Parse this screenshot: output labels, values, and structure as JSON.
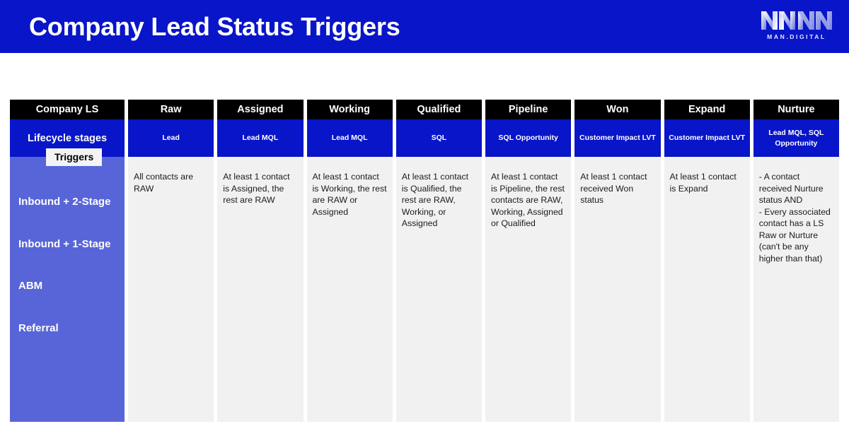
{
  "banner": {
    "title": "Company Lead Status Triggers",
    "bg_color": "#0915c8"
  },
  "logo": {
    "mark_name": "man-digital-zigzag-mark",
    "wordmark": "MAN.DIGITAL"
  },
  "table": {
    "sidebar": {
      "header": "Company LS",
      "stage_label": "Lifecycle stages",
      "badge": "Triggers",
      "rows": [
        {
          "label": "Inbound + 2-Stage"
        },
        {
          "label": "Inbound + 1-Stage"
        },
        {
          "label": "ABM"
        },
        {
          "label": "Referral"
        }
      ]
    },
    "columns": [
      {
        "header": "Raw",
        "stages": "Lead",
        "trigger": "All contacts are RAW"
      },
      {
        "header": "Assigned",
        "stages": "Lead\nMQL",
        "trigger": "At least 1 contact is Assigned, the rest are RAW"
      },
      {
        "header": "Working",
        "stages": "Lead\nMQL",
        "trigger": "At least 1 contact is Working, the rest are RAW or Assigned"
      },
      {
        "header": "Qualified",
        "stages": "SQL",
        "trigger": "At least 1 contact is Qualified, the rest are RAW, Working, or Assigned"
      },
      {
        "header": "Pipeline",
        "stages": "SQL\nOpportunity",
        "trigger": "At least 1 contact is Pipeline, the rest contacts are RAW, Working, Assigned or Qualified"
      },
      {
        "header": "Won",
        "stages": "Customer\nImpact\nLVT",
        "trigger": "At least 1 contact received Won status"
      },
      {
        "header": "Expand",
        "stages": "Customer\nImpact\nLVT",
        "trigger": "At least 1 contact is Expand"
      },
      {
        "header": "Nurture",
        "stages": "Lead\nMQL, SQL\nOpportunity",
        "trigger": "- A contact received Nurture status AND\n- Every associated contact has a LS Raw or Nurture (can't be any higher than that)"
      }
    ]
  },
  "colors": {
    "deep_blue": "#0915c8",
    "periwinkle": "#5865d8",
    "black": "#000000",
    "cell_gray": "#f1f1f1"
  }
}
